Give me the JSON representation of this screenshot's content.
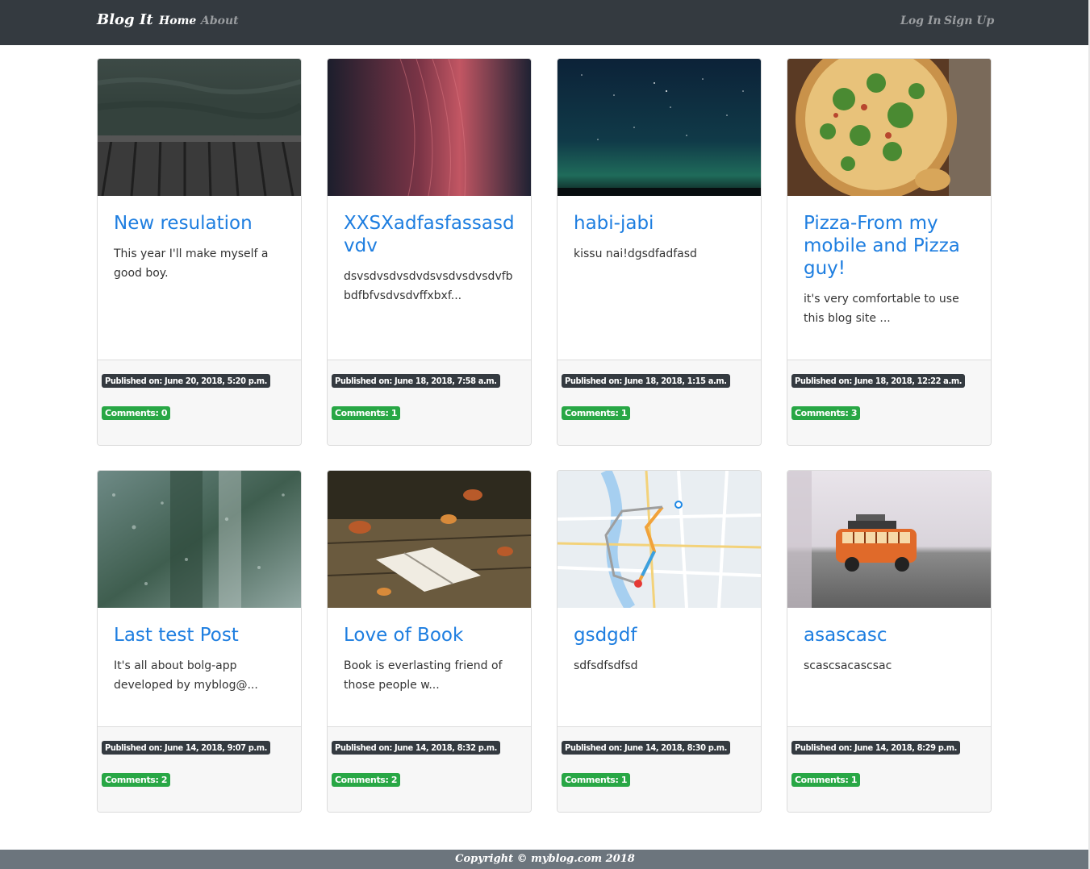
{
  "nav": {
    "brand": "Blog It",
    "home": "Home",
    "about": "About",
    "login": "Log In",
    "signup": "Sign Up"
  },
  "posts": [
    {
      "title": "New resulation",
      "excerpt": "This year I'll make myself a good boy.",
      "published": "Published on: June 20, 2018, 5:20 p.m.",
      "comments": "Comments: 0",
      "image": "wooden-pier-water-photo"
    },
    {
      "title": "XXSXadfasfassasdvdv",
      "excerpt": "dsvsdvsdvsdvdsvsdvsdvsdvfbbdfbfvsdvsdvffxbxf...",
      "published": "Published on: June 18, 2018, 7:58 a.m.",
      "comments": "Comments: 1",
      "image": "red-abstract-texture-photo"
    },
    {
      "title": "habi-jabi",
      "excerpt": "kissu nai!dgsdfadfasd",
      "published": "Published on: June 18, 2018, 1:15 a.m.",
      "comments": "Comments: 1",
      "image": "night-sky-stars-photo"
    },
    {
      "title": "Pizza-From my mobile and Pizza guy!",
      "excerpt": "it's very comfortable to use this blog site ...",
      "published": "Published on: June 18, 2018, 12:22 a.m.",
      "comments": "Comments: 3",
      "image": "pizza-photo"
    },
    {
      "title": "Last test Post",
      "excerpt": "It's all about bolg-app developed by myblog@...",
      "published": "Published on: June 14, 2018, 9:07 p.m.",
      "comments": "Comments: 2",
      "image": "rainy-window-photo"
    },
    {
      "title": "Love of Book",
      "excerpt": "Book is everlasting friend of those people w...",
      "published": "Published on: June 14, 2018, 8:32 p.m.",
      "comments": "Comments: 2",
      "image": "open-book-leaves-photo"
    },
    {
      "title": "gsdgdf",
      "excerpt": "sdfsdfsdfsd",
      "published": "Published on: June 14, 2018, 8:30 p.m.",
      "comments": "Comments: 1",
      "image": "city-map-route-photo"
    },
    {
      "title": "asascasc",
      "excerpt": "scascsacascsac",
      "published": "Published on: June 14, 2018, 8:29 p.m.",
      "comments": "Comments: 1",
      "image": "toy-van-photo"
    }
  ],
  "footer": {
    "copyright": "Copyright © myblog.com 2018"
  }
}
